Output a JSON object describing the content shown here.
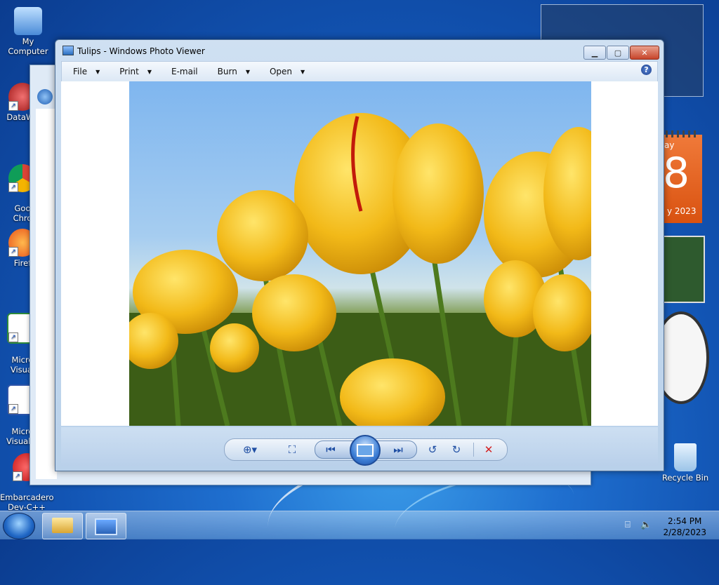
{
  "desktop": {
    "icons": [
      {
        "label": "My Computer"
      },
      {
        "label": "DataWa"
      },
      {
        "label": "Goo\nChro"
      },
      {
        "label": "Firef"
      },
      {
        "label": "Micro\nVisual"
      },
      {
        "label": "Micro\nVisual B"
      },
      {
        "label": "Embarcadero\nDev-C++"
      },
      {
        "label": "Recycle Bin"
      }
    ]
  },
  "photo_viewer": {
    "title": "Tulips - Windows Photo Viewer",
    "menu": [
      {
        "label": "File",
        "has_dropdown": true
      },
      {
        "label": "Print",
        "has_dropdown": true
      },
      {
        "label": "E-mail",
        "has_dropdown": false
      },
      {
        "label": "Burn",
        "has_dropdown": true
      },
      {
        "label": "Open",
        "has_dropdown": true
      }
    ],
    "controls": [
      "zoom",
      "actual-size",
      "previous",
      "play-slideshow",
      "next",
      "rotate-counterclockwise",
      "rotate-clockwise",
      "delete"
    ]
  },
  "gadgets": {
    "calendar": {
      "weekday": "ay",
      "day": "8",
      "month_year": "y 2023"
    }
  },
  "taskbar": {
    "time": "2:54 PM",
    "date": "2/28/2023"
  },
  "colors": {
    "accent": "#1f4ea3",
    "close_button": "#c7452b",
    "calendar": "#e0601c"
  }
}
